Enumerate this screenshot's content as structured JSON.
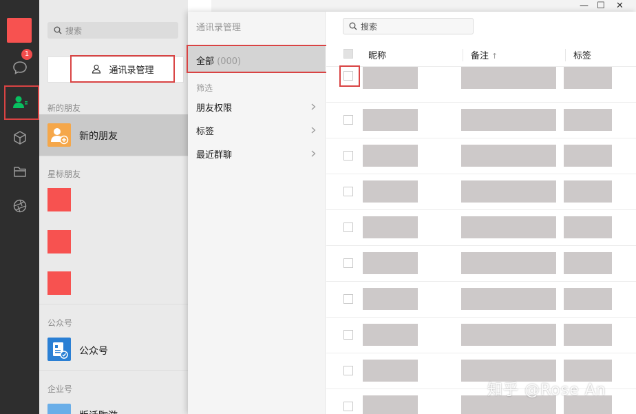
{
  "sidebar": {
    "chat_badge": "1",
    "icons": [
      "chat-icon",
      "contacts-icon",
      "favorites-icon",
      "files-icon",
      "moments-icon"
    ]
  },
  "list_panel": {
    "search_placeholder": "搜索",
    "manage_button": "通讯录管理",
    "sections": {
      "new_friends_header": "新的朋友",
      "new_friends_item": "新的朋友",
      "starred_header": "星标朋友",
      "official_header": "公众号",
      "official_item": "公众号",
      "enterprise_header": "企业号",
      "enterprise_item": "版话陶游"
    }
  },
  "manager": {
    "title": "通讯录管理",
    "all_label": "全部",
    "all_count": "(000)",
    "filter_title": "筛选",
    "filters": [
      "朋友权限",
      "标签",
      "最近群聊"
    ],
    "search_placeholder": "搜索",
    "columns": {
      "nickname": "昵称",
      "remark": "备注",
      "remark_sort": "↑",
      "tag": "标签"
    },
    "row_count": 10
  },
  "watermark": "知乎 @Rose An",
  "colors": {
    "accent_red": "#d94343",
    "sidebar_bg": "#2e2e2e",
    "wechat_green": "#07c160",
    "placeholder_gray": "#cdc9c9"
  }
}
